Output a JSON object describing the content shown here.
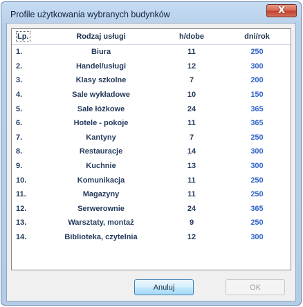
{
  "window": {
    "title": "Profile użytkowania wybranych budynków",
    "close_symbol": "X"
  },
  "table": {
    "headers": {
      "lp": "Lp.",
      "rodzaj": "Rodzaj usługi",
      "h": "h/dobe",
      "dni": "dni/rok"
    },
    "rows": [
      {
        "lp": "1.",
        "rodzaj": "Biura",
        "h": "11",
        "dni": "250"
      },
      {
        "lp": "2.",
        "rodzaj": "Handel/usługi",
        "h": "12",
        "dni": "300"
      },
      {
        "lp": "3.",
        "rodzaj": "Klasy szkolne",
        "h": "7",
        "dni": "200"
      },
      {
        "lp": "4.",
        "rodzaj": "Sale wykładowe",
        "h": "10",
        "dni": "150"
      },
      {
        "lp": "5.",
        "rodzaj": "Sale łóżkowe",
        "h": "24",
        "dni": "365"
      },
      {
        "lp": "6.",
        "rodzaj": "Hotele - pokoje",
        "h": "11",
        "dni": "365"
      },
      {
        "lp": "7.",
        "rodzaj": "Kantyny",
        "h": "7",
        "dni": "250"
      },
      {
        "lp": "8.",
        "rodzaj": "Restauracje",
        "h": "14",
        "dni": "300"
      },
      {
        "lp": "9.",
        "rodzaj": "Kuchnie",
        "h": "13",
        "dni": "300"
      },
      {
        "lp": "10.",
        "rodzaj": "Komunikacja",
        "h": "11",
        "dni": "250"
      },
      {
        "lp": "11.",
        "rodzaj": "Magazyny",
        "h": "11",
        "dni": "250"
      },
      {
        "lp": "12.",
        "rodzaj": "Serwerownie",
        "h": "24",
        "dni": "365"
      },
      {
        "lp": "13.",
        "rodzaj": "Warsztaty, montaż",
        "h": "9",
        "dni": "250"
      },
      {
        "lp": "14.",
        "rodzaj": "Biblioteka, czytelnia",
        "h": "12",
        "dni": "300"
      }
    ]
  },
  "buttons": {
    "cancel": "Anuluj",
    "ok": "OK"
  }
}
